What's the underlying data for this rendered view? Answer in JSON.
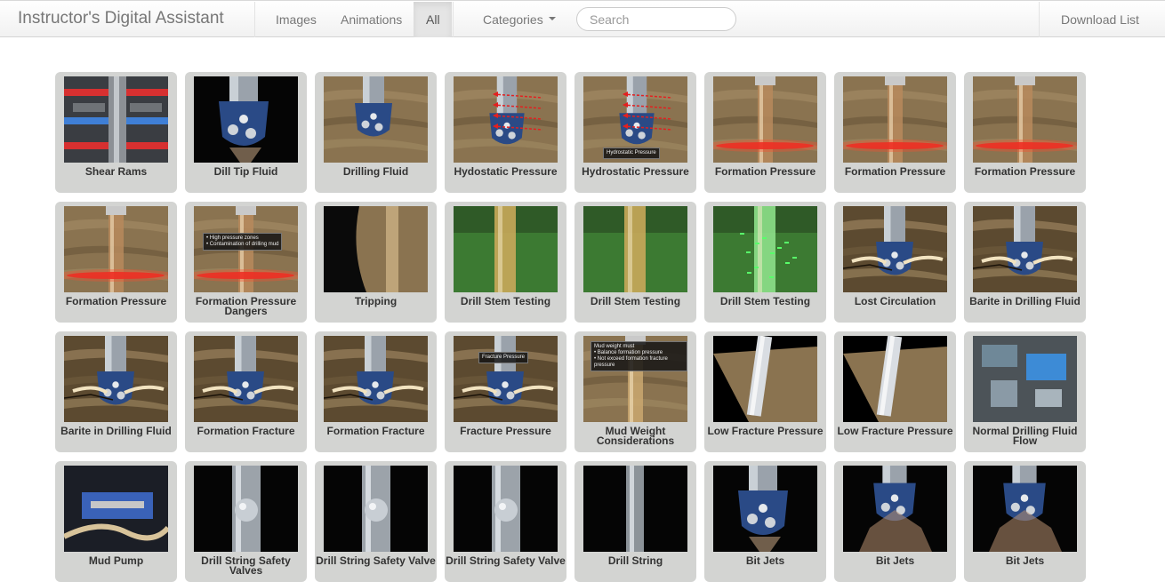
{
  "app": {
    "title": "Instructor's Digital Assistant"
  },
  "nav": {
    "images": "Images",
    "animations": "Animations",
    "all": "All",
    "categories": "Categories",
    "search_placeholder": "Search",
    "download_list": "Download List"
  },
  "items": [
    {
      "label": "Shear Rams",
      "thumb": "shear-rams"
    },
    {
      "label": "Dill Tip Fluid",
      "thumb": "bit-black"
    },
    {
      "label": "Drilling Fluid",
      "thumb": "bit-rock"
    },
    {
      "label": "Hydostatic Pressure",
      "thumb": "bit-rock-arrows"
    },
    {
      "label": "Hydrostatic Pressure",
      "thumb": "bit-rock-arrows-label",
      "overlay": "Hydrostatic Pressure"
    },
    {
      "label": "Formation Pressure",
      "thumb": "pipe-red-zone"
    },
    {
      "label": "Formation Pressure",
      "thumb": "pipe-red-zone"
    },
    {
      "label": "Formation Pressure",
      "thumb": "pipe-red-zone"
    },
    {
      "label": "Formation Pressure",
      "thumb": "pipe-red-zone"
    },
    {
      "label": "Formation Pressure Dangers",
      "thumb": "pipe-red-zone-label",
      "overlay": "• High pressure zones\n• Contamination of drilling mud"
    },
    {
      "label": "Tripping",
      "thumb": "tripping"
    },
    {
      "label": "Drill Stem Testing",
      "thumb": "stem-green"
    },
    {
      "label": "Drill Stem Testing",
      "thumb": "stem-green"
    },
    {
      "label": "Drill Stem Testing",
      "thumb": "stem-green-lit"
    },
    {
      "label": "Lost Circulation",
      "thumb": "bit-fracture"
    },
    {
      "label": "Barite in Drilling Fluid",
      "thumb": "bit-fracture"
    },
    {
      "label": "Barite in Drilling Fluid",
      "thumb": "bit-fracture"
    },
    {
      "label": "Formation Fracture",
      "thumb": "bit-fracture"
    },
    {
      "label": "Formation Fracture",
      "thumb": "bit-fracture"
    },
    {
      "label": "Fracture Pressure",
      "thumb": "bit-fracture-label",
      "overlay": "Fracture Pressure"
    },
    {
      "label": "Mud Weight Considerations",
      "thumb": "mud-weight",
      "overlay": "Mud weight must\n• Balance formation pressure\n• Not exceed formation fracture pressure"
    },
    {
      "label": "Low Fracture Pressure",
      "thumb": "pipe-clear"
    },
    {
      "label": "Low Fracture Pressure",
      "thumb": "pipe-clear"
    },
    {
      "label": "Normal Drilling Fluid Flow",
      "thumb": "rig-site"
    },
    {
      "label": "Mud Pump",
      "thumb": "mud-pump"
    },
    {
      "label": "Drill String Safety Valves",
      "thumb": "valve"
    },
    {
      "label": "Drill String Safety Valve",
      "thumb": "valve"
    },
    {
      "label": "Drill String Safety Valve",
      "thumb": "valve"
    },
    {
      "label": "Drill String",
      "thumb": "drill-string"
    },
    {
      "label": "Bit Jets",
      "thumb": "bit-black"
    },
    {
      "label": "Bit Jets",
      "thumb": "bit-jets"
    },
    {
      "label": "Bit Jets",
      "thumb": "bit-jets"
    }
  ],
  "colors": {
    "tile_bg": "#d3d4d2",
    "rock_brown": "#8a7350",
    "pressure_red": "#e32020",
    "test_green": "#3c7a32"
  }
}
